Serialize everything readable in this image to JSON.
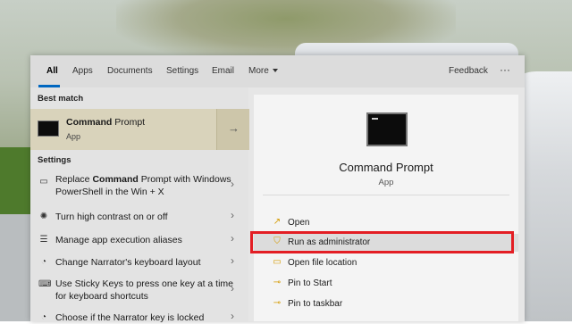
{
  "tabs": {
    "all": "All",
    "apps": "Apps",
    "documents": "Documents",
    "settings": "Settings",
    "email": "Email",
    "more": "More",
    "feedback": "Feedback",
    "overflow": "···"
  },
  "left": {
    "best_match_heading": "Best match",
    "best_match": {
      "title_bold": "Command",
      "title_rest": " Prompt",
      "subtitle": "App",
      "arrow": "→"
    },
    "settings_heading": "Settings",
    "items": [
      {
        "icon": "laptop-icon",
        "pre": "Replace ",
        "bold": "Command",
        "post": " Prompt with Windows PowerShell in the Win + X"
      },
      {
        "icon": "sun-icon",
        "text": "Turn high contrast on or off"
      },
      {
        "icon": "list-icon",
        "text": "Manage app execution aliases"
      },
      {
        "icon": "narrator-icon",
        "text": "Change Narrator's keyboard layout"
      },
      {
        "icon": "keyboard-icon",
        "text": "Use Sticky Keys to press one key at a time for keyboard shortcuts"
      },
      {
        "icon": "narrator-icon",
        "text": "Choose if the Narrator key is locked"
      }
    ],
    "chevron": "›"
  },
  "right": {
    "title": "Command Prompt",
    "subtitle": "App",
    "actions": [
      {
        "label": "Open",
        "icon": "open-icon"
      },
      {
        "label": "Run as administrator",
        "icon": "shield-icon"
      },
      {
        "label": "Open file location",
        "icon": "folder-icon"
      },
      {
        "label": "Pin to Start",
        "icon": "pin-icon"
      },
      {
        "label": "Pin to taskbar",
        "icon": "pin-icon"
      }
    ]
  },
  "colors": {
    "accent": "#0067c0",
    "highlight_box": "#e31e24",
    "icon": "#d49a00"
  }
}
